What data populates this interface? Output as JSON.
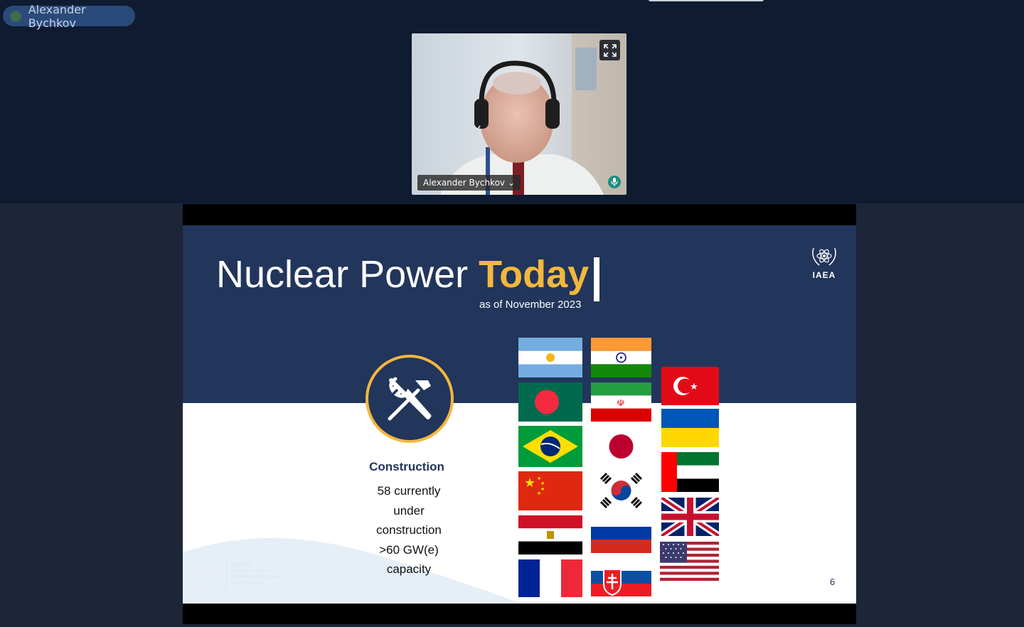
{
  "meeting": {
    "active_speaker": "Alexander Bychkov"
  },
  "video_tile": {
    "participant_name": "Alexander Bychkov",
    "chevron": "⌄",
    "expand_icon": "expand-icon",
    "mic_icon": "microphone-icon"
  },
  "slide": {
    "title_main": "Nuclear Power ",
    "title_accent": "Today",
    "subtitle": "as of November 2023",
    "logo_text": "IAEA",
    "section": {
      "heading": "Construction",
      "lines": [
        "58 currently",
        "under",
        "construction",
        ">60 GW(e)",
        "capacity"
      ]
    },
    "page_number": "6",
    "footer": {
      "logo_text": "IAEA",
      "program": "INPRO",
      "program_line1": "International Project on",
      "program_line2": "Innovative Nuclear Reactors",
      "program_line3": "and Fuel Cycles"
    },
    "flags": [
      "Argentina",
      "Bangladesh",
      "Brazil",
      "China",
      "Egypt",
      "France",
      "India",
      "Iran",
      "Japan",
      "South Korea",
      "Russia",
      "Slovakia",
      "Türkiye",
      "Ukraine",
      "UAE",
      "United Kingdom",
      "United States"
    ]
  },
  "colors": {
    "slide_blue": "#22355b",
    "accent_gold": "#f2b73d",
    "app_background": "#0f1b30",
    "chip_blue": "#2a4a7c",
    "mic_teal": "#1d8f82"
  }
}
